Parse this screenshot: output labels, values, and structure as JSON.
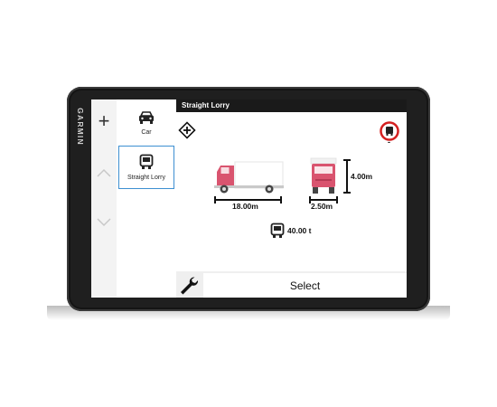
{
  "brand": "GARMIN",
  "sidebar": {
    "add_label": "+"
  },
  "vehicles": [
    {
      "label": "Car",
      "icon": "car-icon",
      "selected": false
    },
    {
      "label": "Straight Lorry",
      "icon": "lorry-icon",
      "selected": true
    }
  ],
  "header": {
    "title": "Straight Lorry"
  },
  "profile": {
    "length": "18.00m",
    "width": "2.50m",
    "height": "4.00m",
    "weight": "40.00 t",
    "restriction_label": "-"
  },
  "actions": {
    "select_label": "Select"
  },
  "colors": {
    "truck": "#d9546f",
    "accent_selection": "#3d8fd1",
    "restriction_red": "#d42020"
  }
}
